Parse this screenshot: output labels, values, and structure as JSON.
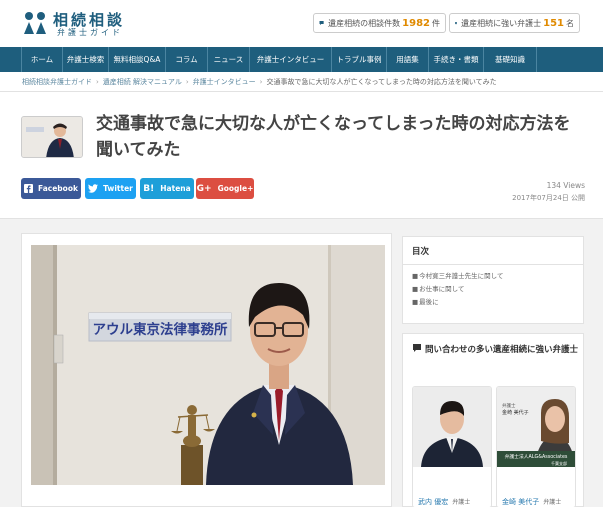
{
  "header": {
    "logo_title": "相続相談",
    "logo_subtitle": "弁護士ガイド",
    "stat1": {
      "label": "遺産相続の相談件数",
      "value": "1982",
      "unit": "件",
      "icon": "chat-icon"
    },
    "stat2": {
      "label": "遺産相続に強い弁護士",
      "value": "151",
      "unit": "名",
      "icon": "person-icon"
    }
  },
  "nav": {
    "items": [
      {
        "label": "ホーム",
        "w": 42
      },
      {
        "label": "弁護士検索",
        "w": 46
      },
      {
        "label": "無料相談Q&A",
        "w": 57
      },
      {
        "label": "コラム",
        "w": 42
      },
      {
        "label": "ニュース",
        "w": 42
      },
      {
        "label": "弁護士インタビュー",
        "w": 82
      },
      {
        "label": "トラブル事例",
        "w": 55
      },
      {
        "label": "用語集",
        "w": 42
      },
      {
        "label": "手続き・書類",
        "w": 55
      },
      {
        "label": "基礎知識",
        "w": 53
      }
    ]
  },
  "breadcrumb": {
    "items": [
      "相続相談弁護士ガイド",
      "遺産相続 解決マニュアル",
      "弁護士インタビュー"
    ],
    "current": "交通事故で急に大切な人が亡くなってしまった時の対応方法を聞いてみた"
  },
  "article": {
    "title": "交通事故で急に大切な人が亡くなってしまった時の対応方法を聞いてみた",
    "views": "134 Views",
    "date": "2017年07月24日 公開",
    "hero_sign": "アウル東京法律事務所"
  },
  "share": {
    "facebook": "Facebook",
    "twitter": "Twitter",
    "hatena_glyph": "B!",
    "hatena": "Hatena",
    "google_glyph": "G+",
    "google": "Google+"
  },
  "toc": {
    "title": "目次",
    "items": [
      "今村寛三弁護士先生に関して",
      "お仕事に関して",
      "最後に"
    ]
  },
  "lawyers": {
    "title": "問い合わせの多い遺産相続に強い弁護士",
    "items": [
      {
        "name": "武内 優宏",
        "title": "弁護士"
      },
      {
        "name": "金崎 美代子",
        "title": "弁護士",
        "photo_caption1": "弁護士",
        "photo_caption2": "金崎 美代子",
        "photo_banner": "弁護士法人ALG&Associates",
        "photo_banner2": "千葉支部"
      }
    ]
  },
  "colors": {
    "brand": "#1e5e7d",
    "accent_number": "#e08a00",
    "facebook": "#3b5998",
    "twitter": "#1da1f2",
    "hatena": "#1e9fd9",
    "google": "#dc4e41"
  }
}
